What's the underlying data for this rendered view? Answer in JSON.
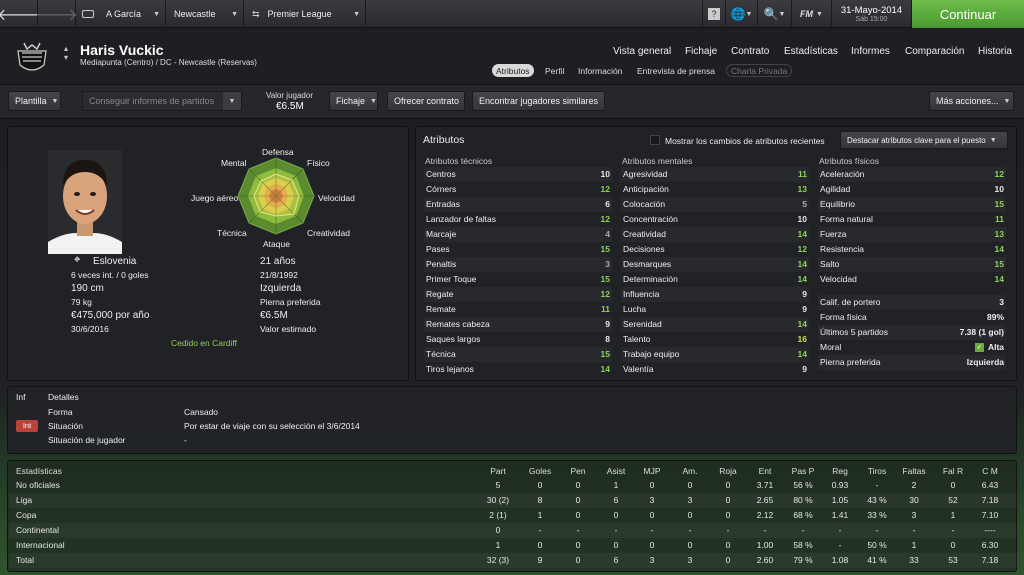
{
  "topbar": {
    "breadcrumb": [
      "A García",
      "Newcastle",
      "Premier League"
    ],
    "date": "31-Mayo-2014",
    "date_sub": "Sáb 15:00",
    "continue": "Continuar",
    "fm_label": "FM"
  },
  "player": {
    "name": "Haris Vuckic",
    "position": "Mediapunta (Centro) / DC - Newcastle (Reservas)"
  },
  "nav": [
    "Vista general",
    "Fichaje",
    "Contrato",
    "Estadísticas",
    "Informes",
    "Comparación",
    "Historia"
  ],
  "subtabs": [
    "Atributos",
    "Perfil",
    "Información",
    "Entrevista de prensa",
    "Charla Privada"
  ],
  "actions": {
    "squad": "Plantilla",
    "reports_placeholder": "Conseguir informes de partidos",
    "value_label": "Valor jugador",
    "value": "€6.5M",
    "transfer": "Fichaje",
    "offer": "Ofrecer contrato",
    "similar": "Encontrar jugadores similares",
    "more": "Más acciones..."
  },
  "profile": {
    "nation": "Eslovenia",
    "caps": "6 veces int. / 0 goles",
    "height": "190 cm",
    "weight": "79 kg",
    "wage": "€475,000 por año",
    "contract_end": "30/6/2016",
    "age": "21 años",
    "dob": "21/8/1992",
    "foot": "Izquierda",
    "foot_label": "Pierna preferida",
    "value": "€6.5M",
    "value_label": "Valor estimado",
    "loan": "Cedido en Cardiff"
  },
  "radar": {
    "labels": [
      "Defensa",
      "Físico",
      "Velocidad",
      "Creatividad",
      "Ataque",
      "Técnica",
      "Juego aéreo",
      "Mental"
    ]
  },
  "attributes": {
    "title": "Atributos",
    "show_changes": "Mostrar los cambios de atributos recientes",
    "highlight": "Destacar atributos clave para el puesto",
    "technical_title": "Atributos técnicos",
    "mental_title": "Atributos mentales",
    "physical_title": "Atributos físicos",
    "technical": [
      [
        "Centros",
        "10"
      ],
      [
        "Córners",
        "12"
      ],
      [
        "Entradas",
        "6"
      ],
      [
        "Lanzador de faltas",
        "12"
      ],
      [
        "Marcaje",
        "4"
      ],
      [
        "Pases",
        "15"
      ],
      [
        "Penaltis",
        "3"
      ],
      [
        "Primer Toque",
        "15"
      ],
      [
        "Regate",
        "12"
      ],
      [
        "Remate",
        "11"
      ],
      [
        "Remates cabeza",
        "9"
      ],
      [
        "Saques largos",
        "8"
      ],
      [
        "Técnica",
        "15"
      ],
      [
        "Tiros lejanos",
        "14"
      ]
    ],
    "mental": [
      [
        "Agresividad",
        "11"
      ],
      [
        "Anticipación",
        "13"
      ],
      [
        "Colocación",
        "5"
      ],
      [
        "Concentración",
        "10"
      ],
      [
        "Creatividad",
        "14"
      ],
      [
        "Decisiones",
        "12"
      ],
      [
        "Desmarques",
        "14"
      ],
      [
        "Determinación",
        "14"
      ],
      [
        "Influencia",
        "9"
      ],
      [
        "Lucha",
        "9"
      ],
      [
        "Serenidad",
        "14"
      ],
      [
        "Talento",
        "16"
      ],
      [
        "Trabajo equipo",
        "14"
      ],
      [
        "Valentía",
        "9"
      ]
    ],
    "physical": [
      [
        "Aceleración",
        "12"
      ],
      [
        "Agilidad",
        "10"
      ],
      [
        "Equilibrio",
        "15"
      ],
      [
        "Forma natural",
        "11"
      ],
      [
        "Fuerza",
        "13"
      ],
      [
        "Resistencia",
        "14"
      ],
      [
        "Salto",
        "15"
      ],
      [
        "Velocidad",
        "14"
      ]
    ],
    "extra": [
      [
        "Calif. de portero",
        "3"
      ],
      [
        "Forma física",
        "89%"
      ],
      [
        "Últimos 5 partidos",
        "7.38 (1 gol)"
      ],
      [
        "Moral",
        "Alta"
      ],
      [
        "Pierna preferida",
        "Izquierda"
      ]
    ]
  },
  "details": {
    "tab_inf": "Inf",
    "tab_det": "Detalles",
    "rows": [
      [
        "Forma",
        "Cansado"
      ],
      [
        "Situación",
        "Por estar de viaje con su selección el 3/6/2014"
      ],
      [
        "Situación de jugador",
        "-"
      ]
    ],
    "badge": "Int"
  },
  "stats": {
    "title": "Estadísticas",
    "headers": [
      "Part",
      "Goles",
      "Pen",
      "Asist",
      "MJP",
      "Am.",
      "Roja",
      "Ent",
      "Pas P",
      "Reg",
      "Tiros",
      "Faltas",
      "Fal R",
      "C M"
    ],
    "rows": [
      [
        "No oficiales",
        "5",
        "0",
        "0",
        "1",
        "0",
        "0",
        "0",
        "3.71",
        "56 %",
        "0.93",
        "-",
        "2",
        "0",
        "6.43"
      ],
      [
        "Liga",
        "30 (2)",
        "8",
        "0",
        "6",
        "3",
        "3",
        "0",
        "2.65",
        "80 %",
        "1.05",
        "43 %",
        "30",
        "52",
        "7.18"
      ],
      [
        "Copa",
        "2 (1)",
        "1",
        "0",
        "0",
        "0",
        "0",
        "0",
        "2.12",
        "68 %",
        "1.41",
        "33 %",
        "3",
        "1",
        "7.10"
      ],
      [
        "Continental",
        "0",
        "-",
        "-",
        "-",
        "-",
        "-",
        "-",
        "-",
        "-",
        "-",
        "-",
        "-",
        "-",
        "----"
      ],
      [
        "Internacional",
        "1",
        "0",
        "0",
        "0",
        "0",
        "0",
        "0",
        "1.00",
        "58 %",
        "-",
        "50 %",
        "1",
        "0",
        "6.30"
      ],
      [
        "Total",
        "32 (3)",
        "9",
        "0",
        "6",
        "3",
        "3",
        "0",
        "2.60",
        "79 %",
        "1.08",
        "41 %",
        "33",
        "53",
        "7.18"
      ]
    ]
  }
}
